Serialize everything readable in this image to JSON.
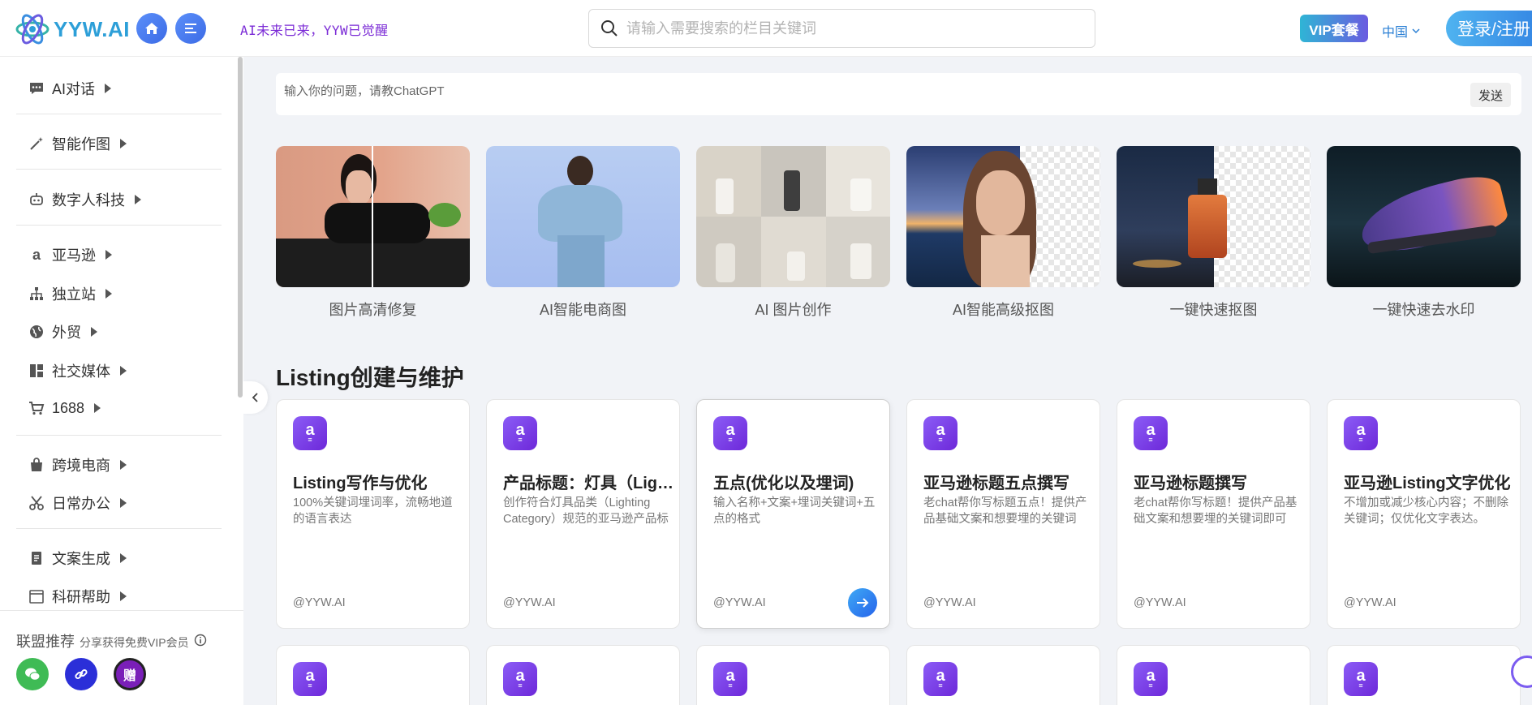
{
  "header": {
    "logo_text": "YYW.AI",
    "slogan": "AI未来已来，YYW已觉醒",
    "search_placeholder": "请输入需要搜索的栏目关键词",
    "vip_label": "VIP套餐",
    "region_label": "中国",
    "login_label": "登录/注册",
    "colors": {
      "logo": "#2d9fd8",
      "slogan": "#7b2bd6",
      "accent": "#2f7de1"
    }
  },
  "sidebar": {
    "items": [
      {
        "label": "AI对话",
        "icon": "chat-icon"
      },
      {
        "label": "智能作图",
        "icon": "magic-wand-icon"
      },
      {
        "label": "数字人科技",
        "icon": "robot-icon"
      },
      {
        "label": "亚马逊",
        "icon": "amazon-icon"
      },
      {
        "label": "独立站",
        "icon": "sitemap-icon"
      },
      {
        "label": "外贸",
        "icon": "globe-icon"
      },
      {
        "label": "社交媒体",
        "icon": "grid-icon"
      },
      {
        "label": "1688",
        "icon": "cart-icon"
      },
      {
        "label": "跨境电商",
        "icon": "bag-icon"
      },
      {
        "label": "日常办公",
        "icon": "scissors-icon"
      },
      {
        "label": "文案生成",
        "icon": "document-icon"
      },
      {
        "label": "科研帮助",
        "icon": "calendar-icon"
      }
    ],
    "affiliate": {
      "title": "联盟推荐",
      "subtitle": "分享获得免费VIP会员",
      "gift_label": "赠"
    }
  },
  "ask": {
    "placeholder": "输入你的问题，请教ChatGPT",
    "send_label": "发送"
  },
  "tools": [
    {
      "label": "图片高清修复"
    },
    {
      "label": "AI智能电商图"
    },
    {
      "label": "AI 图片创作"
    },
    {
      "label": "AI智能高级抠图"
    },
    {
      "label": "一键快速抠图"
    },
    {
      "label": "一键快速去水印"
    }
  ],
  "section": {
    "title": "Listing创建与维护",
    "cards": [
      {
        "title": "Listing写作与优化",
        "desc": "100%关键词埋词率，流畅地道的语言表达",
        "by": "@YYW.AI"
      },
      {
        "title": "产品标题：灯具（Lighting Category）",
        "desc": "创作符合灯具品类（Lighting Category）规范的亚马逊产品标题",
        "by": "@YYW.AI"
      },
      {
        "title": "五点(优化以及埋词)",
        "desc": "输入名称+文案+埋词关键词+五点的格式",
        "by": "@YYW.AI"
      },
      {
        "title": "亚马逊标题五点撰写",
        "desc": "老chat帮你写标题五点！提供产品基础文案和想要埋的关键词",
        "by": "@YYW.AI"
      },
      {
        "title": "亚马逊标题撰写",
        "desc": "老chat帮你写标题！提供产品基础文案和想要埋的关键词即可",
        "by": "@YYW.AI"
      },
      {
        "title": "亚马逊Listing文字优化",
        "desc": "不增加或减少核心内容；不删除关键词；仅优化文字表达。",
        "by": "@YYW.AI"
      }
    ]
  }
}
